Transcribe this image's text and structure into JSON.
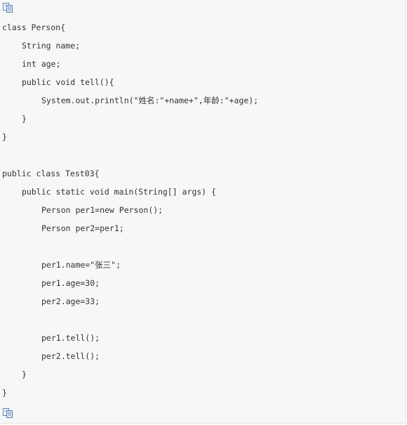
{
  "toolbar": {
    "copy_icon_top": "copy-icon",
    "copy_icon_bottom": "copy-icon"
  },
  "code": {
    "lines": [
      "class Person{",
      "String name;",
      "int age;",
      "public void tell(){",
      "System.out.println(\"姓名:\"+name+\",年龄:\"+age);",
      "}",
      "}",
      "public class Test03{",
      "public static void main(String[] args) {",
      "Person per1=new Person();",
      "Person per2=per1;",
      "per1.name=\"张三\";",
      "per1.age=30;",
      "per2.age=33;",
      "per1.tell();",
      "per2.tell();",
      "}",
      "}"
    ]
  }
}
